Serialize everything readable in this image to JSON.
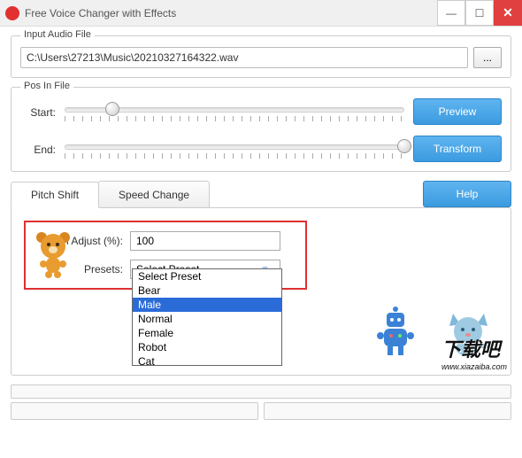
{
  "window": {
    "title": "Free Voice Changer with Effects"
  },
  "input_audio": {
    "group_label": "Input Audio File",
    "path": "C:\\Users\\27213\\Music\\20210327164322.wav",
    "browse_label": "..."
  },
  "pos_in_file": {
    "group_label": "Pos In File",
    "start_label": "Start:",
    "end_label": "End:",
    "start_pos_pct": 14,
    "end_pos_pct": 100,
    "preview_label": "Preview",
    "transform_label": "Transform"
  },
  "tabs": {
    "pitch_shift": "Pitch Shift",
    "speed_change": "Speed Change",
    "help_label": "Help",
    "active": "pitch_shift"
  },
  "pitch_panel": {
    "adjust_label": "Pitch Adjust (%):",
    "adjust_value": "100",
    "presets_label": "Presets:",
    "combo_text": "Select Preset",
    "options": [
      "Select Preset",
      "Bear",
      "Male",
      "Normal",
      "Female",
      "Robot",
      "Cat"
    ],
    "highlighted": "Male"
  },
  "watermark": {
    "big": "下载吧",
    "small": "www.xiazaiba.com"
  }
}
